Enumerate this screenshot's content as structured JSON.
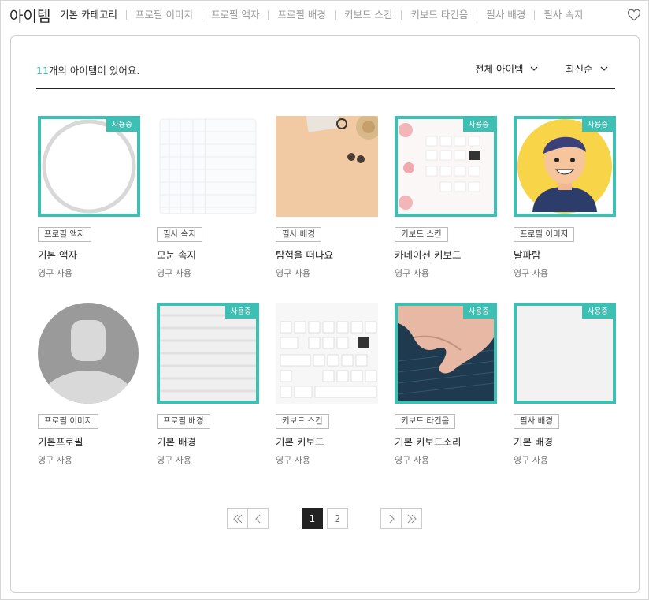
{
  "header": {
    "title": "아이템",
    "tabs": [
      "기본 카테고리",
      "프로필 이미지",
      "프로필 액자",
      "프로필 배경",
      "키보드 스킨",
      "키보드 타건음",
      "필사 배경",
      "필사 속지"
    ]
  },
  "toolbar": {
    "count_num": "11",
    "count_text": "개의 아이템이 있어요.",
    "filter_label": "전체 아이템",
    "sort_label": "최신순"
  },
  "badge_label": "사용중",
  "items": [
    {
      "tag": "프로필 액자",
      "name": "기본 액자",
      "use": "영구 사용",
      "in_use": true
    },
    {
      "tag": "필사 속지",
      "name": "모눈 속지",
      "use": "영구 사용",
      "in_use": false
    },
    {
      "tag": "필사 배경",
      "name": "탐험을 떠나요",
      "use": "영구 사용",
      "in_use": false
    },
    {
      "tag": "키보드 스킨",
      "name": "카네이션 키보드",
      "use": "영구 사용",
      "in_use": true
    },
    {
      "tag": "프로필 이미지",
      "name": "날파람",
      "use": "영구 사용",
      "in_use": true
    },
    {
      "tag": "프로필 이미지",
      "name": "기본프로필",
      "use": "영구 사용",
      "in_use": false
    },
    {
      "tag": "프로필 배경",
      "name": "기본 배경",
      "use": "영구 사용",
      "in_use": true
    },
    {
      "tag": "키보드 스킨",
      "name": "기본 키보드",
      "use": "영구 사용",
      "in_use": false
    },
    {
      "tag": "키보드 타건음",
      "name": "기본 키보드소리",
      "use": "영구 사용",
      "in_use": true
    },
    {
      "tag": "필사 배경",
      "name": "기본 배경",
      "use": "영구 사용",
      "in_use": true
    }
  ],
  "pagination": {
    "pages": [
      "1",
      "2"
    ],
    "current": "1"
  },
  "colors": {
    "accent": "#3ebfb4",
    "text": "#222222",
    "muted": "#999999"
  }
}
